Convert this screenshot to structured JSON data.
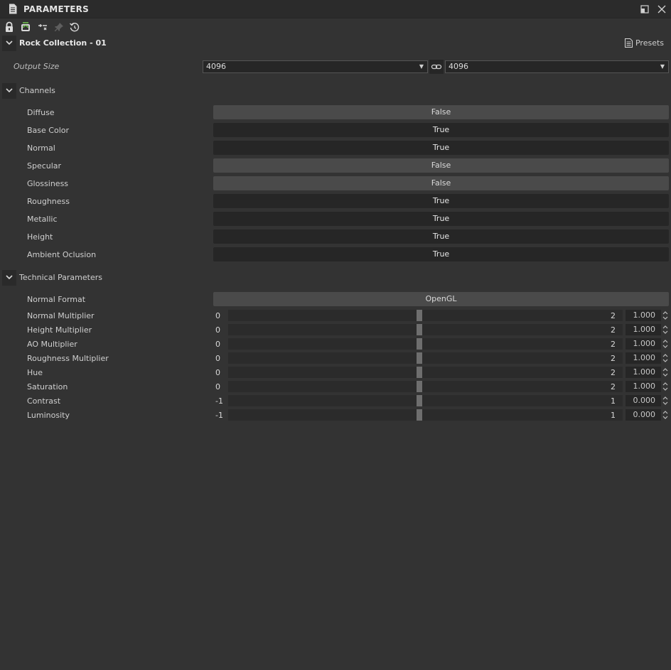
{
  "panel": {
    "title": "PARAMETERS"
  },
  "header": {
    "name": "Rock Collection - 01",
    "presets_label": "Presets"
  },
  "output": {
    "label": "Output Size",
    "width_value": "4096",
    "height_value": "4096"
  },
  "channels": {
    "label": "Channels",
    "items": [
      {
        "label": "Diffuse",
        "value": "False"
      },
      {
        "label": "Base Color",
        "value": "True"
      },
      {
        "label": "Normal",
        "value": "True"
      },
      {
        "label": "Specular",
        "value": "False"
      },
      {
        "label": "Glossiness",
        "value": "False"
      },
      {
        "label": "Roughness",
        "value": "True"
      },
      {
        "label": "Metallic",
        "value": "True"
      },
      {
        "label": "Height",
        "value": "True"
      },
      {
        "label": "Ambient Oclusion",
        "value": "True"
      }
    ]
  },
  "technical": {
    "label": "Technical Parameters",
    "normal_format": {
      "label": "Normal Format",
      "value": "OpenGL"
    },
    "sliders": [
      {
        "label": "Normal Multiplier",
        "min": "0",
        "max": "2",
        "value": "1.000"
      },
      {
        "label": "Height Multiplier",
        "min": "0",
        "max": "2",
        "value": "1.000"
      },
      {
        "label": "AO Multiplier",
        "min": "0",
        "max": "2",
        "value": "1.000"
      },
      {
        "label": "Roughness Multiplier",
        "min": "0",
        "max": "2",
        "value": "1.000"
      },
      {
        "label": "Hue",
        "min": "0",
        "max": "2",
        "value": "1.000"
      },
      {
        "label": "Saturation",
        "min": "0",
        "max": "2",
        "value": "1.000"
      },
      {
        "label": "Contrast",
        "min": "-1",
        "max": "1",
        "value": "0.000"
      },
      {
        "label": "Luminosity",
        "min": "-1",
        "max": "1",
        "value": "0.000"
      }
    ]
  },
  "icons": {
    "doc": "document-icon",
    "maximize": "maximize-icon",
    "close": "close-icon",
    "lock": "lock-icon",
    "refresh": "refresh-icon",
    "plug": "plug-icon",
    "pin": "pin-icon",
    "reset": "reset-icon",
    "link": "link-icon"
  },
  "colors": {
    "panel_bg": "#333333",
    "button_true": "#262626",
    "button_false": "#4a4a4a",
    "accent_green": "#6dbf4b"
  }
}
